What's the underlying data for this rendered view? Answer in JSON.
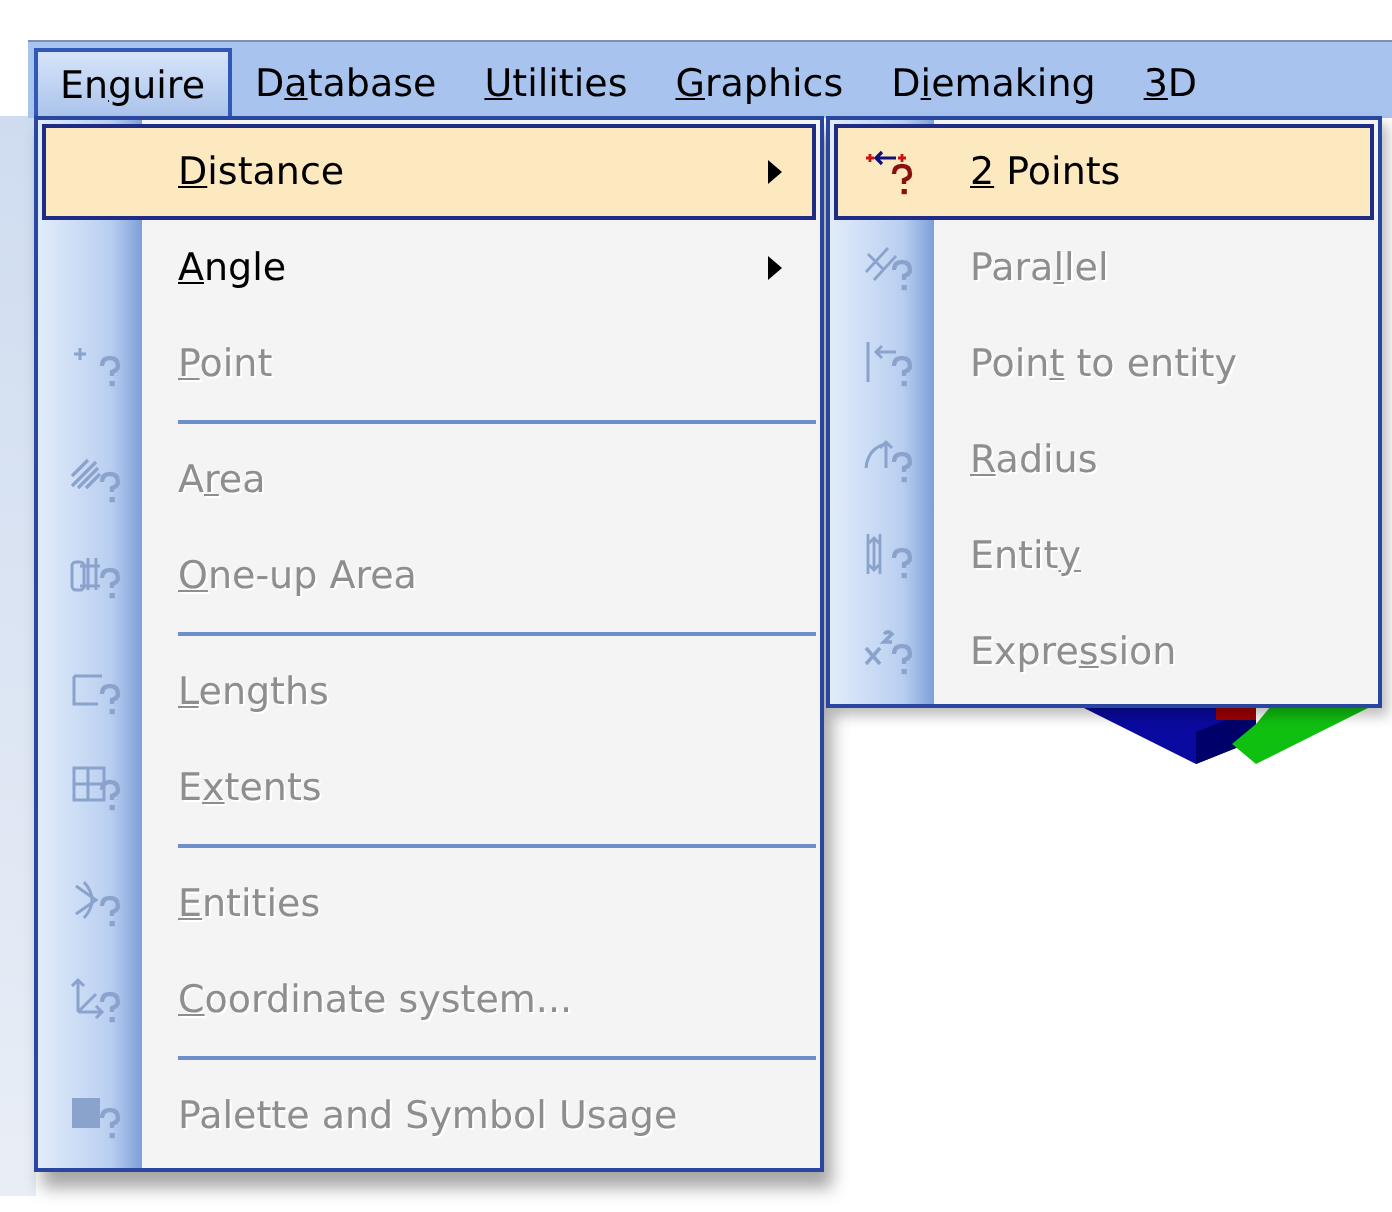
{
  "menubar": [
    {
      "pre": "En",
      "key": "g",
      "post": "uire",
      "selected": true
    },
    {
      "pre": "D",
      "key": "a",
      "post": "tabase",
      "selected": false
    },
    {
      "key": "U",
      "post": "tilities",
      "selected": false
    },
    {
      "key": "G",
      "post": "raphics",
      "selected": false
    },
    {
      "pre": "D",
      "key": "i",
      "post": "emaking",
      "selected": false
    },
    {
      "key": "3",
      "post": "D",
      "selected": false
    }
  ],
  "menu": [
    {
      "kind": "command",
      "key": "D",
      "post": "istance",
      "disabled": false,
      "selected": true,
      "submenu": true
    },
    {
      "kind": "command",
      "key": "A",
      "post": "ngle",
      "disabled": false,
      "selected": false,
      "submenu": true
    },
    {
      "kind": "command",
      "key": "P",
      "post": "oint",
      "disabled": true,
      "selected": false,
      "submenu": false
    },
    {
      "kind": "separator"
    },
    {
      "kind": "command",
      "pre": "A",
      "key": "r",
      "post": "ea",
      "disabled": true,
      "selected": false,
      "submenu": false
    },
    {
      "kind": "command",
      "key": "O",
      "post": "ne-up Area",
      "disabled": true,
      "selected": false,
      "submenu": false
    },
    {
      "kind": "separator"
    },
    {
      "kind": "command",
      "key": "L",
      "post": "engths",
      "disabled": true,
      "selected": false,
      "submenu": false
    },
    {
      "kind": "command",
      "pre": "E",
      "key": "x",
      "post": "tents",
      "disabled": true,
      "selected": false,
      "submenu": false
    },
    {
      "kind": "separator"
    },
    {
      "kind": "command",
      "key": "E",
      "post": "ntities",
      "disabled": true,
      "selected": false,
      "submenu": false
    },
    {
      "kind": "command",
      "key": "C",
      "post": "oordinate system...",
      "disabled": true,
      "selected": false,
      "submenu": false
    },
    {
      "kind": "separator"
    },
    {
      "kind": "command",
      "pre": "Palette and Symbol Usage",
      "disabled": true,
      "selected": false,
      "submenu": false
    }
  ],
  "submenu": [
    {
      "kind": "command",
      "key": "2",
      "post": " Points",
      "disabled": false,
      "selected": true,
      "submenu": false
    },
    {
      "kind": "command",
      "pre": "Para",
      "key": "l",
      "post": "lel",
      "disabled": true,
      "selected": false,
      "submenu": false
    },
    {
      "kind": "command",
      "pre": "Poin",
      "key": "t",
      "post": " to entity",
      "disabled": true,
      "selected": false,
      "submenu": false
    },
    {
      "kind": "command",
      "key": "R",
      "post": "adius",
      "disabled": true,
      "selected": false,
      "submenu": false
    },
    {
      "kind": "command",
      "pre": "Entit",
      "key": "y",
      "disabled": true,
      "selected": false,
      "submenu": false
    },
    {
      "kind": "command",
      "pre": "Expre",
      "key": "s",
      "post": "sion",
      "disabled": true,
      "selected": false,
      "submenu": false
    }
  ]
}
